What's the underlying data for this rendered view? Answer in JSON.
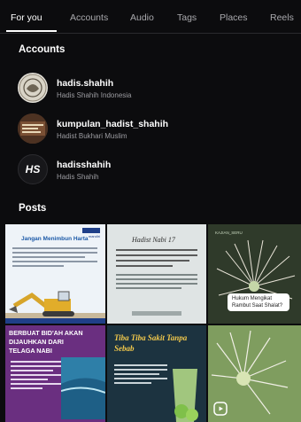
{
  "tabs": [
    {
      "label": "For you"
    },
    {
      "label": "Accounts"
    },
    {
      "label": "Audio"
    },
    {
      "label": "Tags"
    },
    {
      "label": "Places"
    },
    {
      "label": "Reels"
    }
  ],
  "accounts_section": {
    "title": "Accounts"
  },
  "accounts": [
    {
      "username": "hadis.shahih",
      "subtitle": "Hadis Shahih Indonesia"
    },
    {
      "username": "kumpulan_hadist_shahih",
      "subtitle": "Hadist Bukhari Muslim"
    },
    {
      "username": "hadisshahih",
      "subtitle": "Hadis Shahih",
      "avatar_text": "HS"
    }
  ],
  "posts_section": {
    "title": "Posts"
  },
  "posts": [
    {
      "title": "Jangan Menimbun Harta",
      "brand": "mandiri"
    },
    {
      "title": "Hadist Nabi 17"
    },
    {
      "handle": "KAJIAN_SERU",
      "caption": "Hukum Mengikat Rambut Saat Shalat?"
    },
    {
      "title": "BERBUAT BID'AH AKAN DIJAUHKAN DARI TELAGA NABI"
    },
    {
      "title": "Tiba Tiba Sakit Tanpa Sebab"
    },
    {
      "icon": "reels-icon"
    }
  ],
  "colors": {
    "background": "#0c0c0e",
    "accent_post4": "#6a2f80",
    "accent_post5": "#1c3340"
  }
}
